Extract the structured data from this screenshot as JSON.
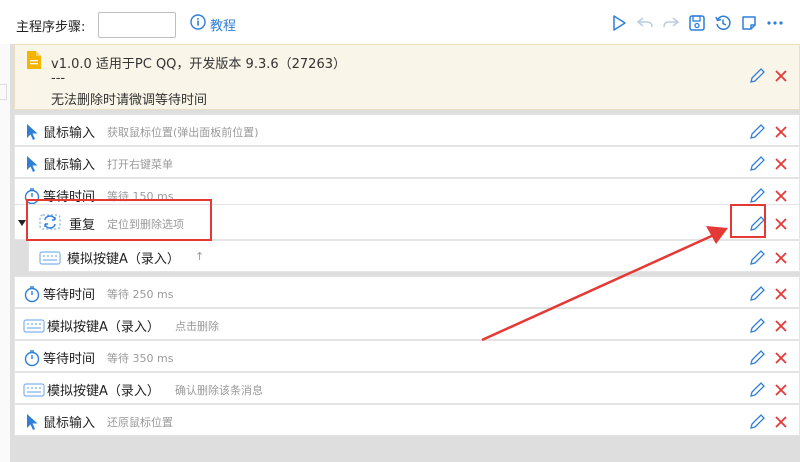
{
  "header": {
    "steps_label": "主程序步骤:",
    "steps_value": "",
    "tutorial_label": "教程"
  },
  "toolbar": {
    "icons": [
      "play-icon",
      "undo-icon",
      "redo-icon",
      "save-icon",
      "history-icon",
      "note-icon",
      "more-icon"
    ]
  },
  "note": {
    "line1": "v1.0.0 适用于PC QQ，开发版本 9.3.6（27263）",
    "line2": "---",
    "line3": "无法删除时请微调等待时间"
  },
  "steps": [
    {
      "name": "鼠标输入",
      "desc": "获取鼠标位置(弹出面板前位置)",
      "icon": "cursor-icon"
    },
    {
      "name": "鼠标输入",
      "desc": "打开右键菜单",
      "icon": "cursor-icon"
    },
    {
      "name": "等待时间",
      "desc": "等待 150 ms",
      "icon": "timer-icon"
    },
    {
      "name": "重复",
      "desc": "定位到删除选项",
      "icon": "repeat-icon"
    },
    {
      "name": "模拟按键A（录入）",
      "desc": "↑",
      "icon": "keyboard-icon"
    },
    {
      "name": "等待时间",
      "desc": "等待 250 ms",
      "icon": "timer-icon"
    },
    {
      "name": "模拟按键A（录入）",
      "desc": "点击删除",
      "icon": "keyboard-icon"
    },
    {
      "name": "等待时间",
      "desc": "等待 350 ms",
      "icon": "timer-icon"
    },
    {
      "name": "模拟按键A（录入）",
      "desc": "确认删除该条消息",
      "icon": "keyboard-icon"
    },
    {
      "name": "鼠标输入",
      "desc": "还原鼠标位置",
      "icon": "cursor-icon"
    }
  ],
  "colors": {
    "accent": "#2f7fd8",
    "delete": "#e53935",
    "highlight": "#e53935"
  }
}
